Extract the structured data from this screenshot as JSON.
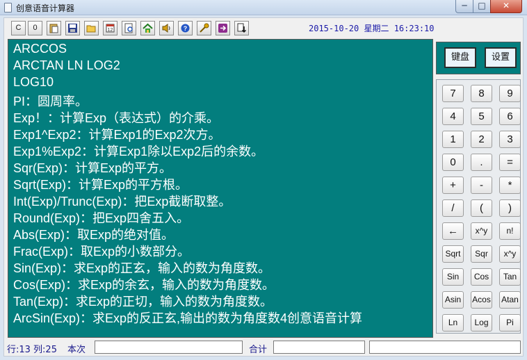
{
  "window": {
    "title": "创意语音计算器",
    "minimize": "─",
    "maximize": "□",
    "close": "✕"
  },
  "toolbar": {
    "buttons": [
      {
        "label": "C",
        "icon": "clear-icon"
      },
      {
        "label": "0",
        "icon": "zero-icon"
      },
      {
        "label": "",
        "icon": "paste-icon"
      },
      {
        "label": "",
        "icon": "save-icon"
      },
      {
        "label": "",
        "icon": "open-folder-icon"
      },
      {
        "label": "",
        "icon": "calendar-icon"
      },
      {
        "label": "",
        "icon": "preview-icon"
      },
      {
        "label": "",
        "icon": "home-icon"
      },
      {
        "label": "",
        "icon": "speaker-icon"
      },
      {
        "label": "",
        "icon": "help-icon"
      },
      {
        "label": "",
        "icon": "key-icon"
      },
      {
        "label": "",
        "icon": "exit-icon"
      },
      {
        "label": "",
        "icon": "download-icon"
      }
    ],
    "datetime": "2015-10-20 星期二 16:23:10"
  },
  "content": {
    "lines": [
      "ARCCOS",
      "ARCTAN LN LOG2",
      "LOG10",
      "PI：圆周率。",
      "Exp！：计算Exp（表达式）的介乘。",
      "Exp1^Exp2：计算Exp1的Exp2次方。",
      "Exp1%Exp2：计算Exp1除以Exp2后的余数。",
      "Sqr(Exp)：计算Exp的平方。",
      "Sqrt(Exp)：计算Exp的平方根。",
      "Int(Exp)/Trunc(Exp)：把Exp截断取整。",
      "Round(Exp)：把Exp四舍五入。",
      "Abs(Exp)：取Exp的绝对值。",
      "Frac(Exp)：取Exp的小数部分。",
      "Sin(Exp)：求Exp的正玄，输入的数为角度数。",
      "Cos(Exp)：求Exp的余玄，输入的数为角度数。",
      "Tan(Exp)：求Exp的正切，输入的数为角度数。",
      "ArcSin(Exp)：求Exp的反正玄,输出的数为角度数4创意语音计算"
    ]
  },
  "panel": {
    "keyboard_label": "键盘",
    "settings_label": "设置",
    "keys": [
      [
        "7",
        "8",
        "9"
      ],
      [
        "4",
        "5",
        "6"
      ],
      [
        "1",
        "2",
        "3"
      ],
      [
        "0",
        ".",
        "="
      ],
      [
        "+",
        "-",
        "*"
      ],
      [
        "/",
        "(",
        ")"
      ],
      [
        "←",
        "x^y",
        "n!"
      ],
      [
        "Sqrt",
        "Sqr",
        "x^y"
      ],
      [
        "Sin",
        "Cos",
        "Tan"
      ],
      [
        "Asin",
        "Acos",
        "Atan"
      ],
      [
        "Ln",
        "Log",
        "Pi"
      ]
    ]
  },
  "status": {
    "position": "行:13 列:25",
    "current_label": "本次",
    "current_value": "",
    "total_label": "合计",
    "total_value": "",
    "extra_value": ""
  }
}
